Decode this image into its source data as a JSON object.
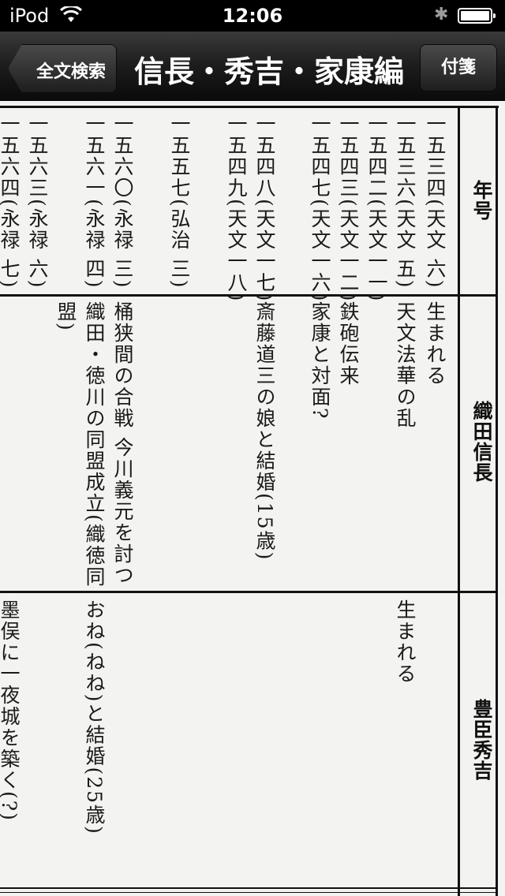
{
  "status": {
    "device": "iPod",
    "time": "12:06"
  },
  "nav": {
    "back_label": "全文検索",
    "title": "信長・秀吉・家康編",
    "right_label": "付箋"
  },
  "table": {
    "headers": {
      "year": "年号",
      "nobunaga": "織田信長",
      "hideyoshi": "豊臣秀吉"
    },
    "rows": [
      {
        "year": "一五三四(天文 六)",
        "nobunaga": "生まれる",
        "hideyoshi": ""
      },
      {
        "year": "一五三六(天文 五)",
        "nobunaga": "天文法華の乱",
        "hideyoshi": "生まれる"
      },
      {
        "year": "一五四二(天文一一)",
        "nobunaga": "",
        "hideyoshi": ""
      },
      {
        "year": "一五四三(天文一二)",
        "nobunaga": "鉄砲伝来",
        "hideyoshi": ""
      },
      {
        "year": "一五四七(天文一六)",
        "nobunaga": "家康と対面?",
        "hideyoshi": ""
      },
      {
        "year": "一五四八(天文一七)",
        "nobunaga": "斎藤道三の娘と結婚(15歳)",
        "hideyoshi": ""
      },
      {
        "year": "一五四九(天文一八)",
        "nobunaga": "",
        "hideyoshi": ""
      },
      {
        "year": "一五五七(弘治 三)",
        "nobunaga": "",
        "hideyoshi": ""
      },
      {
        "year": "一五六〇(永禄 三)",
        "nobunaga": "桶狭間の合戦 今川義元を討つ",
        "hideyoshi": ""
      },
      {
        "year": "一五六一(永禄 四)",
        "nobunaga": "織田・徳川の同盟成立(織徳同",
        "nobunaga_cont": "盟)",
        "hideyoshi": "おね(ねね)と結婚(25歳)"
      },
      {
        "year": "一五六三(永禄 六)",
        "nobunaga": "",
        "hideyoshi": ""
      },
      {
        "year": "一五六四(永禄 七)",
        "nobunaga": "",
        "hideyoshi": "墨俣に一夜城を築く(?)"
      }
    ]
  }
}
